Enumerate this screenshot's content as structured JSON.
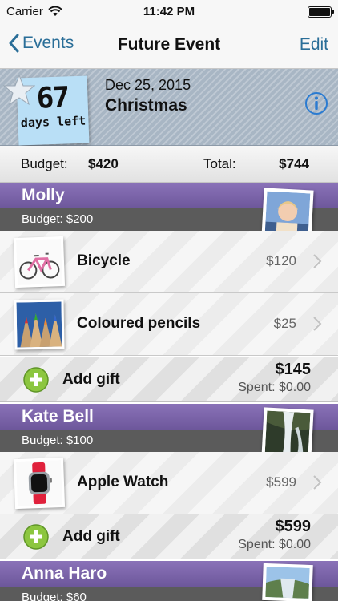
{
  "status": {
    "carrier": "Carrier",
    "time": "11:42 PM"
  },
  "nav": {
    "back_label": "Events",
    "title": "Future Event",
    "edit_label": "Edit"
  },
  "event": {
    "days": "67",
    "days_label": "days left",
    "date": "Dec 25, 2015",
    "name": "Christmas"
  },
  "budget": {
    "budget_label": "Budget:",
    "budget_value": "$420",
    "total_label": "Total:",
    "total_value": "$744"
  },
  "people": [
    {
      "name": "Molly",
      "budget": "Budget: $200",
      "gifts": [
        {
          "name": "Bicycle",
          "price": "$120",
          "icon": "bicycle-photo"
        },
        {
          "name": "Coloured pencils",
          "price": "$25",
          "icon": "pencils-photo"
        }
      ],
      "add_label": "Add gift",
      "total": "$145",
      "spent": "Spent: $0.00"
    },
    {
      "name": "Kate Bell",
      "budget": "Budget: $100",
      "gifts": [
        {
          "name": "Apple Watch",
          "price": "$599",
          "icon": "watch-photo"
        }
      ],
      "add_label": "Add gift",
      "total": "$599",
      "spent": "Spent: $0.00"
    },
    {
      "name": "Anna Haro",
      "budget": "Budget: $60"
    }
  ],
  "colors": {
    "accent": "#2a6e98",
    "person_header": "#7b64ab",
    "add_green": "#8cc63f",
    "sticky_note": "#b9dff6"
  }
}
